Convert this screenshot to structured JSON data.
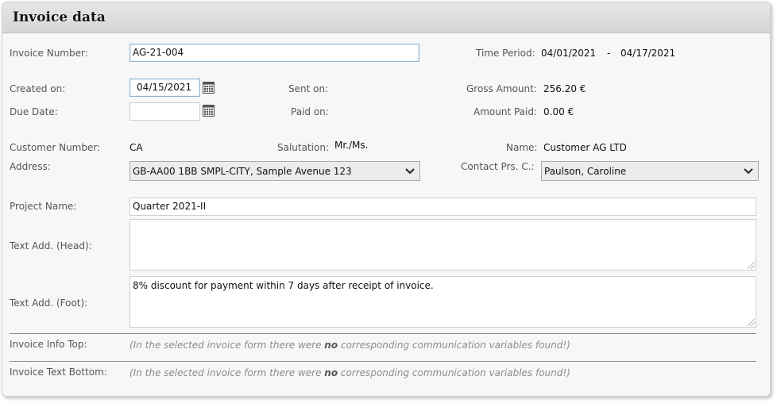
{
  "header": {
    "title": "Invoice data"
  },
  "invoice": {
    "number_label": "Invoice Number:",
    "number_value": "AG-21-004",
    "time_period_label": "Time Period:",
    "time_period_from": "04/01/2021",
    "time_period_sep": "-",
    "time_period_to": "04/17/2021",
    "created_label": "Created on:",
    "created_value": "04/15/2021",
    "sent_label": "Sent on:",
    "gross_label": "Gross Amount:",
    "gross_value": "256.20 €",
    "due_label": "Due Date:",
    "due_value": "",
    "paid_label": "Paid on:",
    "amount_paid_label": "Amount Paid:",
    "amount_paid_value": "0.00 €"
  },
  "customer": {
    "number_label": "Customer Number:",
    "number_value": "CA",
    "salutation_label": "Salutation:",
    "salutation_value": "Mr./Ms.",
    "name_label": "Name:",
    "name_value": "Customer AG LTD",
    "address_label": "Address:",
    "address_value": "GB-AA00 1BB SMPL-CITY, Sample Avenue 123",
    "contact_label": "Contact Prs. C.:",
    "contact_value": "Paulson, Caroline"
  },
  "project": {
    "name_label": "Project Name:",
    "name_value": "Quarter 2021-II",
    "head_label": "Text Add. (Head):",
    "head_value": "",
    "foot_label": "Text Add. (Foot):",
    "foot_value": "8% discount for payment within 7 days after receipt of invoice."
  },
  "info": {
    "top_label": "Invoice Info Top:",
    "bottom_label": "Invoice Text Bottom:",
    "note_pre": "(In the selected invoice form there were ",
    "note_bold": "no",
    "note_post": " corresponding communication variables found!)"
  },
  "icons": {
    "calendar": "calendar-icon",
    "dropdown": "chevron-down-icon"
  }
}
